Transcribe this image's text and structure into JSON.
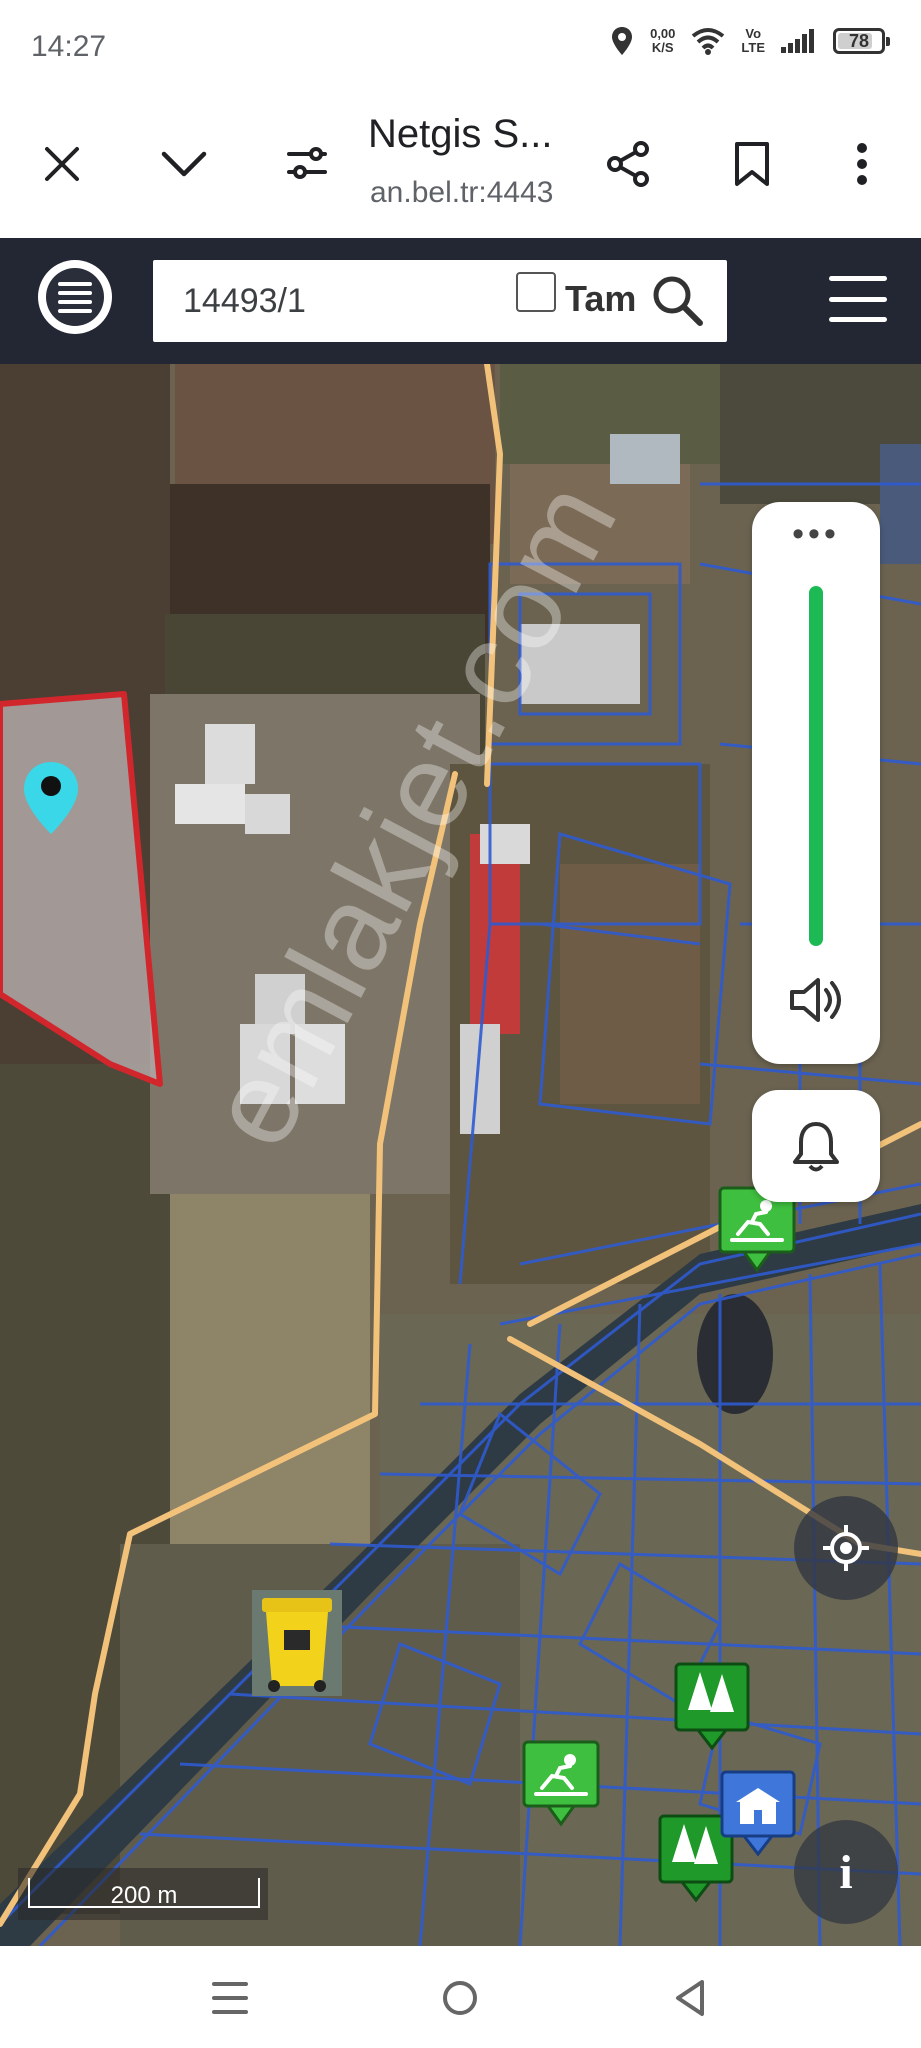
{
  "status_bar": {
    "time": "14:27",
    "net_speed_value": "0,00",
    "net_speed_unit": "K/S",
    "volte_top": "Vo",
    "volte_bottom": "LTE",
    "battery": "78"
  },
  "browser": {
    "tab_title": "Netgis S...",
    "url": "an.bel.tr:4443",
    "icons": [
      "close-icon",
      "chevron-down-icon",
      "site-settings-icon",
      "share-icon",
      "bookmark-icon",
      "more-vert-icon"
    ]
  },
  "app_header": {
    "search_value": "14493/1",
    "tam_label": "Tam",
    "tam_checked": false,
    "icons": [
      "layers-icon",
      "search-icon",
      "hamburger-menu-icon"
    ]
  },
  "map": {
    "watermark": "emlakjet.com",
    "scale_label": "200 m",
    "info_label": "i",
    "volume_dots": "•••",
    "volume_level": 1.0,
    "colors": {
      "parcel_lines": "#2f5bd0",
      "road": "#f2c27a",
      "selected_parcel": "#d2262d",
      "marker": "#3ad7e8",
      "volume_track": "#1db954",
      "poi_green": "#3fbf3f",
      "poi_forest": "#1f9a2a",
      "poi_blue": "#3f76d9",
      "bin_yellow": "#f2d21a"
    }
  },
  "nav_bar": {
    "icons": [
      "recent-apps-icon",
      "home-icon",
      "back-icon"
    ]
  }
}
